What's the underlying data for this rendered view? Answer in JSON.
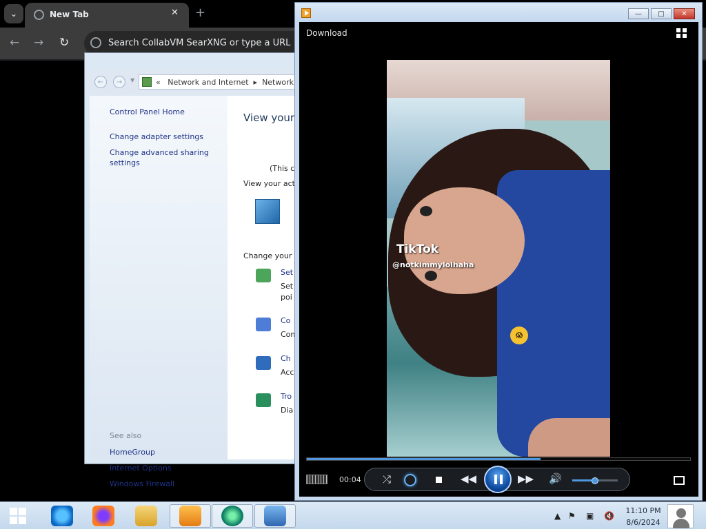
{
  "browser": {
    "tab_title": "New Tab",
    "tab_close": "✕",
    "new_tab": "+",
    "back": "←",
    "forward": "→",
    "reload": "↻",
    "address_placeholder": "Search CollabVM SearXNG or type a URL"
  },
  "control_panel": {
    "breadcrumb": [
      "«",
      "Network and Internet",
      "▸",
      "Network a"
    ],
    "left_links": {
      "home": "Control Panel Home",
      "adapter": "Change adapter settings",
      "sharing": "Change advanced sharing settings"
    },
    "see_also_label": "See also",
    "see_also": [
      "HomeGroup",
      "Internet Options",
      "Windows Firewall"
    ],
    "main": {
      "title": "View your",
      "fragment_1": "(This c",
      "active_networks": "View your acti",
      "change_networking": "Change your",
      "tasks": [
        {
          "title": "Set",
          "line_1": "Set",
          "line_2": "poi"
        },
        {
          "title": "Co",
          "line_1": "Con"
        },
        {
          "title": "Ch",
          "line_1": "Acc"
        },
        {
          "title": "Tro",
          "line_1": "Dia"
        }
      ]
    }
  },
  "media_player": {
    "download": "Download",
    "time": "00:04",
    "progress": 0.61,
    "volume": 0.5,
    "overlay": {
      "brand": "TikTok",
      "handle": "@notkimmylolhaha",
      "emoji": "😱"
    }
  },
  "taskbar": {
    "time": "11:10 PM",
    "date": "8/6/2024",
    "apps": [
      "start",
      "internet-explorer",
      "firefox",
      "file-explorer",
      "media-player",
      "edge",
      "control-panel"
    ]
  },
  "colors": {
    "browser_bg": "#202124",
    "player_accent": "#4f98df",
    "taskbar": "#c4d8ec"
  }
}
